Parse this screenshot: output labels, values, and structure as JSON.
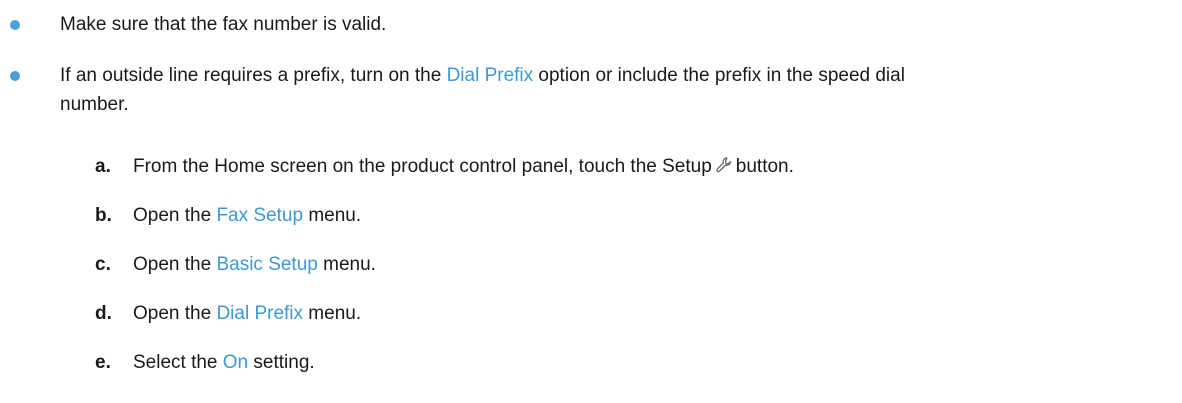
{
  "bullets": [
    {
      "text": "Make sure that the fax number is valid."
    },
    {
      "pre": "If an outside line requires a prefix, turn on the ",
      "highlight": "Dial Prefix",
      "line1_post": " option or include the prefix in the speed dial",
      "line2": "number."
    }
  ],
  "steps": [
    {
      "letter": "a.",
      "pre": "From the Home screen on the product control panel, touch the Setup",
      "icon": "wrench-icon",
      "post": "button."
    },
    {
      "letter": "b.",
      "pre": "Open the ",
      "highlight": "Fax Setup",
      "post": " menu."
    },
    {
      "letter": "c.",
      "pre": "Open the ",
      "highlight": "Basic Setup",
      "post": " menu."
    },
    {
      "letter": "d.",
      "pre": "Open the ",
      "highlight": "Dial Prefix",
      "post": " menu."
    },
    {
      "letter": "e.",
      "pre": "Select the ",
      "highlight": "On",
      "post": " setting."
    }
  ],
  "colors": {
    "link": "#3d9ad4",
    "bullet": "#4b9fd9",
    "text": "#1a1a1a"
  }
}
